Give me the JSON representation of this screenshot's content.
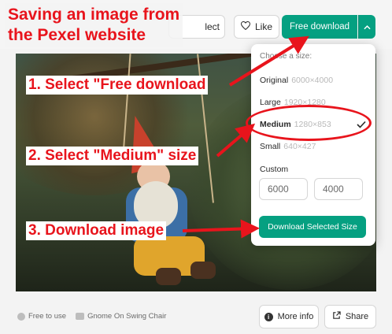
{
  "header": {
    "collect_label": "lect",
    "like_label": "Like",
    "like_icon": "heart-outline-icon",
    "free_download_label": "Free download",
    "caret_icon": "chevron-up-icon"
  },
  "photo": {
    "alt": "Gnome On Swing Chair"
  },
  "dropdown": {
    "heading": "Choose a size:",
    "options": [
      {
        "name": "Original",
        "dims": "6000×4000"
      },
      {
        "name": "Large",
        "dims": "1920×1280"
      },
      {
        "name": "Medium",
        "dims": "1280×853",
        "selected": true
      },
      {
        "name": "Small",
        "dims": "640×427"
      }
    ],
    "check_icon": "checkmark-icon",
    "custom_label": "Custom",
    "custom_width": "6000",
    "custom_height": "4000",
    "download_selected_label": "Download Selected Size"
  },
  "footer": {
    "free_to_use": "Free to use",
    "photo_title": "Gnome On Swing Chair",
    "more_info_label": "More info",
    "share_label": "Share"
  },
  "annotations": {
    "title_line1": "Saving an image from",
    "title_line2": "the Pexel website",
    "step1": "1. Select \"Free download",
    "step2": "2. Select \"Medium\" size",
    "step3": "3. Download image",
    "annotation_color": "#e8141c"
  },
  "colors": {
    "accent": "#05a081"
  }
}
